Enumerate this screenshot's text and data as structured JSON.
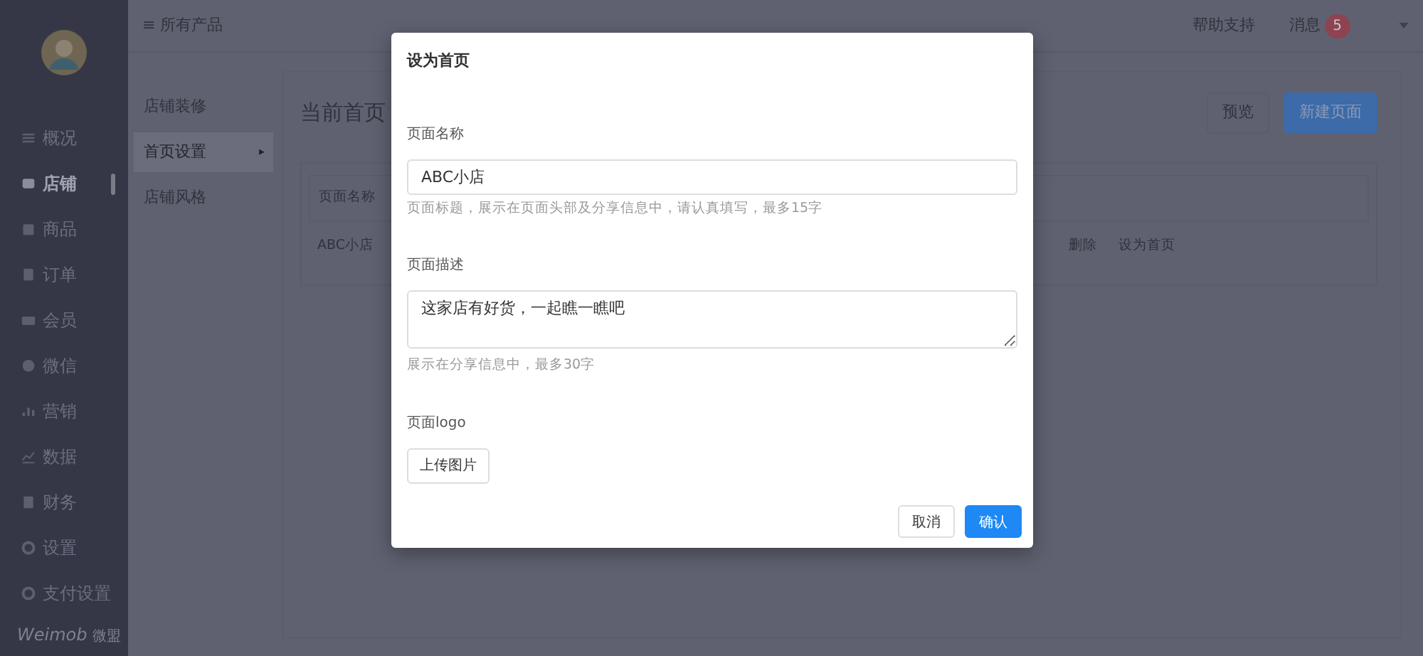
{
  "sidebar": {
    "items": [
      {
        "label": "概况",
        "selected": false
      },
      {
        "label": "店铺",
        "selected": true
      },
      {
        "label": "商品",
        "selected": false
      },
      {
        "label": "订单",
        "selected": false
      },
      {
        "label": "会员",
        "selected": false
      },
      {
        "label": "微信",
        "selected": false
      },
      {
        "label": "营销",
        "selected": false
      },
      {
        "label": "数据",
        "selected": false
      },
      {
        "label": "财务",
        "selected": false
      },
      {
        "label": "设置",
        "selected": false
      },
      {
        "label": "支付设置",
        "selected": false
      }
    ],
    "brand": {
      "name": "Weimob",
      "suffix": "微盟"
    }
  },
  "header": {
    "menu_glyph": "≡",
    "products": "所有产品",
    "help": "帮助支持",
    "messages": "消息",
    "message_count": "5"
  },
  "subnav": [
    {
      "label": "店铺装修",
      "selected": false
    },
    {
      "label": "首页设置",
      "selected": true,
      "arrow": "▸"
    },
    {
      "label": "店铺风格",
      "selected": false
    }
  ],
  "content": {
    "title": "当前首页",
    "buttons": [
      {
        "label": "预览",
        "kind": "default"
      },
      {
        "label": "新建页面",
        "kind": "primary"
      }
    ],
    "table": {
      "columns": [
        "页面名称"
      ],
      "rows": [
        {
          "name": "ABC小店",
          "actions": [
            "删除",
            "设为首页"
          ]
        }
      ]
    }
  },
  "dialog": {
    "title": "设为首页",
    "fields": [
      {
        "kind": "input",
        "label": "页面名称",
        "value": "ABC小店",
        "help": "页面标题，展示在页面头部及分享信息中，请认真填写，最多15字"
      },
      {
        "kind": "textarea",
        "label": "页面描述",
        "value": "这家店有好货，一起瞧一瞧吧",
        "help": "展示在分享信息中，最多30字"
      },
      {
        "kind": "upload",
        "label": "页面logo",
        "button": "上传图片"
      }
    ],
    "buttons": [
      {
        "label": "取消",
        "kind": "default"
      },
      {
        "label": "确认",
        "kind": "primary"
      }
    ]
  }
}
